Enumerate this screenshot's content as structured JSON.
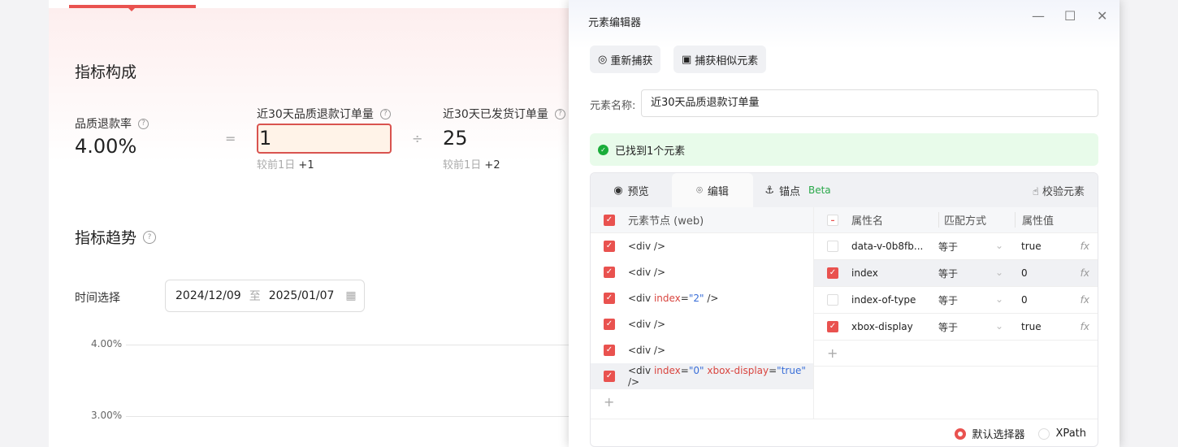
{
  "page": {
    "section1": "指标构成",
    "metric": {
      "label": "品质退款率",
      "value": "4.00%"
    },
    "eq": "=",
    "div": "÷",
    "numerator": {
      "label": "近30天品质退款订单量",
      "value": "1",
      "cmp": "较前1日",
      "delta": "+1"
    },
    "denominator": {
      "label": "近30天已发货订单量",
      "value": "25",
      "cmp": "较前1日",
      "delta": "+2"
    },
    "section2": "指标趋势",
    "time_label": "时间选择",
    "date_start": "2024/12/09",
    "date_sep": "至",
    "date_end": "2025/01/07",
    "y_ticks": [
      "4.00%",
      "3.00%"
    ]
  },
  "dialog": {
    "title": "元素编辑器",
    "recapture": "重新捕获",
    "capture_similar": "捕获相似元素",
    "name_label": "元素名称:",
    "name_value": "近30天品质退款订单量",
    "found": "已找到1个元素",
    "tabs": [
      "预览",
      "编辑",
      "锚点"
    ],
    "beta": "Beta",
    "verify": "校验元素",
    "node_header": "元素节点 (web)",
    "nodes": [
      {
        "tag": "<div",
        "attrs": []
      },
      {
        "tag": "<div",
        "attrs": []
      },
      {
        "tag": "<div",
        "attrs": [
          {
            "n": "index",
            "v": "2"
          }
        ]
      },
      {
        "tag": "<div",
        "attrs": []
      },
      {
        "tag": "<div",
        "attrs": []
      },
      {
        "tag": "<div",
        "attrs": [
          {
            "n": "index",
            "v": "0"
          },
          {
            "n": "xbox-display",
            "v": "true"
          }
        ]
      }
    ],
    "attr_headers": [
      "属性名",
      "匹配方式",
      "属性值"
    ],
    "attrs": [
      {
        "name": "data-v-0b8fb...",
        "match": "等于",
        "value": "true",
        "checked": false
      },
      {
        "name": "index",
        "match": "等于",
        "value": "0",
        "checked": true
      },
      {
        "name": "index-of-type",
        "match": "等于",
        "value": "0",
        "checked": false
      },
      {
        "name": "xbox-display",
        "match": "等于",
        "value": "true",
        "checked": true
      }
    ],
    "fx": "fx",
    "selector_default": "默认选择器",
    "selector_xpath": "XPath"
  }
}
